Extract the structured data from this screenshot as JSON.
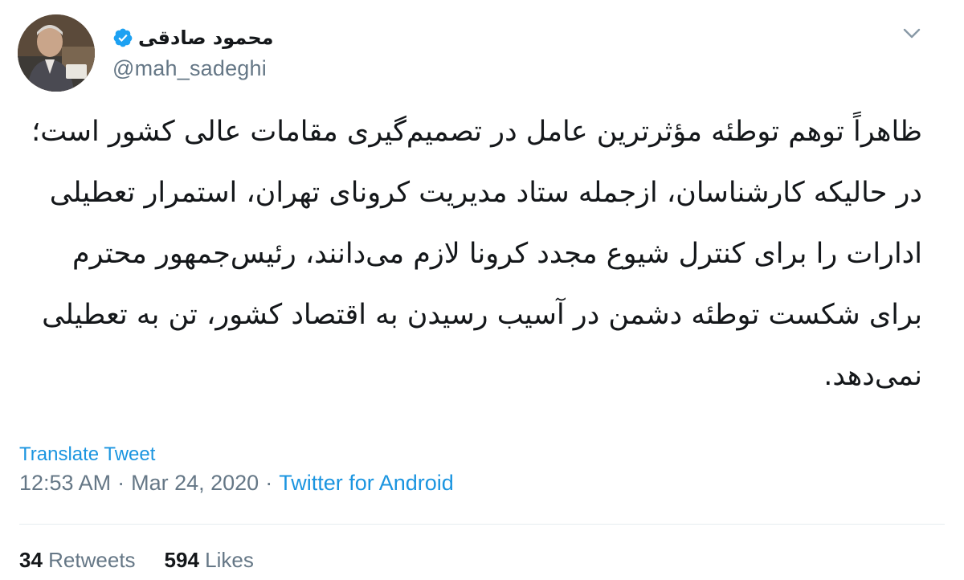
{
  "tweet": {
    "author": {
      "display_name": "محمود صادقی",
      "handle": "@mah_sadeghi",
      "verified": true,
      "avatar_icon": "avatar-photo"
    },
    "menu_icon": "chevron-down-icon",
    "text": "ظاهراً توهم توطئه مؤثرترین عامل در تصمیم‌گیری مقامات عالی کشور است؛ در حالیکه کارشناسان، ازجمله ستاد مدیریت کرونای تهران، استمرار تعطیلی ادارات را برای کنترل شیوع مجدد کرونا لازم می‌دانند، رئیس‌جمهور محترم برای شکست توطئه دشمن در آسیب رسیدن به اقتصاد کشور، تن به تعطیلی نمی‌دهد.",
    "translate_label": "Translate Tweet",
    "time": "12:53 AM",
    "date": "Mar 24, 2020",
    "separator": "·",
    "source": "Twitter for Android",
    "retweets_count": "34",
    "retweets_label": "Retweets",
    "likes_count": "594",
    "likes_label": "Likes"
  },
  "colors": {
    "link": "#1b95e0",
    "secondary": "#657786",
    "verified": "#1da1f2",
    "text": "#14171a"
  }
}
